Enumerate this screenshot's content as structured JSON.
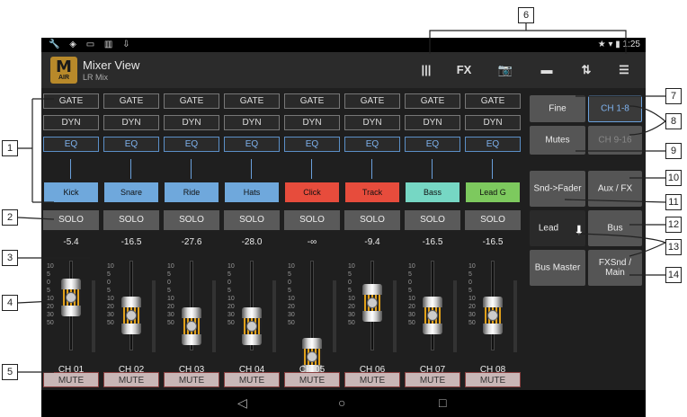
{
  "status": {
    "left_icons": "🔧 ◈ ▭ ▥ ⇩",
    "right": "★ ▾ ▮ 1:25"
  },
  "app": {
    "title": "Mixer View",
    "subtitle": "LR Mix",
    "logo_mark": "M",
    "logo_text": "AIR"
  },
  "toolbar": [
    {
      "icon": "meters-icon",
      "glyph": "|||"
    },
    {
      "icon": "fx-icon",
      "glyph": "FX"
    },
    {
      "icon": "camera-icon",
      "glyph": "📷"
    },
    {
      "icon": "folder-icon",
      "glyph": "▬"
    },
    {
      "icon": "transfer-icon",
      "glyph": "⇅"
    },
    {
      "icon": "sliders-icon",
      "glyph": "☰"
    }
  ],
  "strip_labels": {
    "gate": "GATE",
    "dyn": "DYN",
    "eq": "EQ",
    "solo": "SOLO",
    "mute": "MUTE"
  },
  "scale_marks": [
    "10",
    "5",
    "0",
    "5",
    "10",
    "20",
    "30",
    "50"
  ],
  "channels": [
    {
      "name": "Kick",
      "color": "#6fa8dc",
      "level": "-5.4",
      "id": "CH 01",
      "fader": 0.78
    },
    {
      "name": "Snare",
      "color": "#6fa8dc",
      "level": "-16.5",
      "id": "CH 02",
      "fader": 0.55
    },
    {
      "name": "Ride",
      "color": "#6fa8dc",
      "level": "-27.6",
      "id": "CH 03",
      "fader": 0.4
    },
    {
      "name": "Hats",
      "color": "#6fa8dc",
      "level": "-28.0",
      "id": "CH 04",
      "fader": 0.4
    },
    {
      "name": "Click",
      "color": "#e74c3c",
      "level": "-∞",
      "id": "CH 05",
      "fader": 0.0
    },
    {
      "name": "Track",
      "color": "#e74c3c",
      "level": "-9.4",
      "id": "CH 06",
      "fader": 0.72
    },
    {
      "name": "Bass",
      "color": "#76d7c4",
      "level": "-16.5",
      "id": "CH 07",
      "fader": 0.55
    },
    {
      "name": "Lead G",
      "color": "#7dc95e",
      "level": "-16.5",
      "id": "CH 08",
      "fader": 0.55
    }
  ],
  "right_panel": {
    "fine": "Fine",
    "ch_range": "CH 1-8",
    "mutes": "Mutes",
    "ch_range2": "CH 9-16",
    "snd_fader": "Snd->Fader",
    "aux_fx": "Aux / FX",
    "lead": "Lead",
    "bus": "Bus",
    "bus_master": "Bus Master",
    "fxsnd_main": "FXSnd / Main"
  },
  "nav": {
    "back": "◁",
    "home": "○",
    "recent": "□"
  },
  "callouts": [
    "1",
    "2",
    "3",
    "4",
    "5",
    "6",
    "7",
    "8",
    "9",
    "10",
    "11",
    "12",
    "13",
    "14"
  ],
  "colors": {
    "accent_blue": "#6aa0dc",
    "screen_bg": "#1f1f1f"
  }
}
